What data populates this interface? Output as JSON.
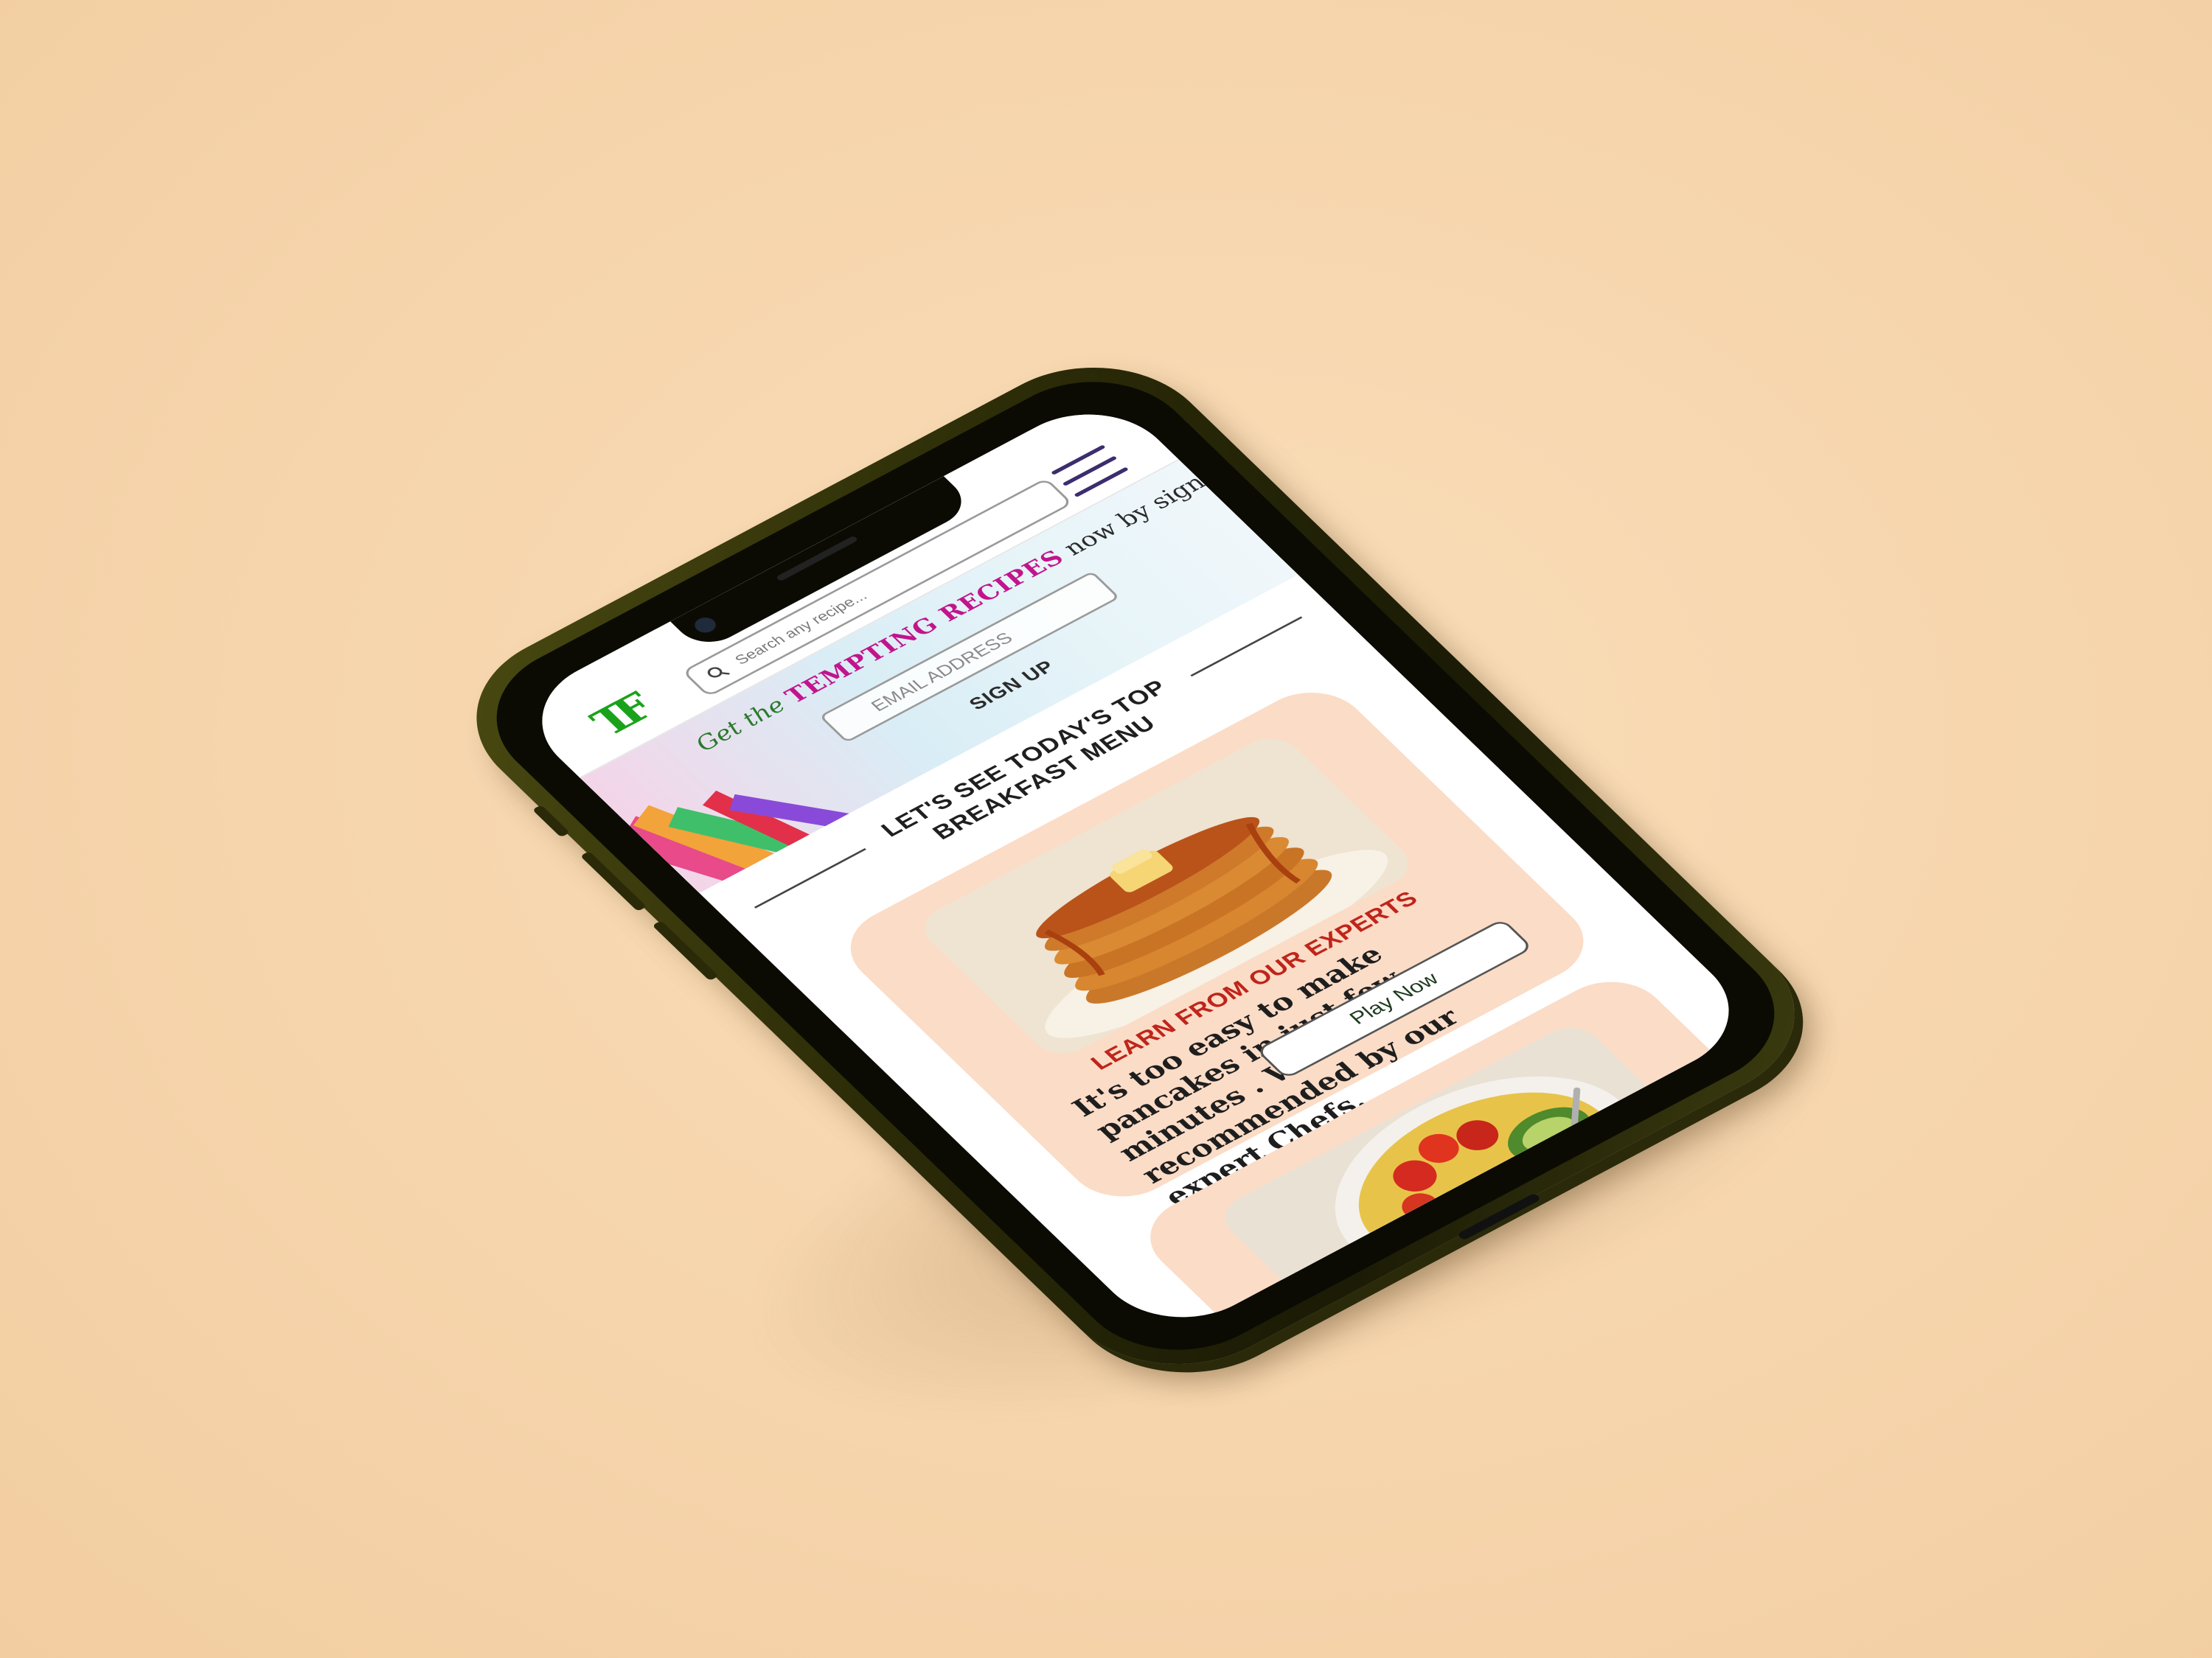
{
  "header": {
    "logo_text": "TF",
    "search": {
      "placeholder": "Search any recipe..."
    },
    "menu_icon": "hamburger-menu-icon"
  },
  "hero": {
    "line_prefix": "Get the",
    "line_highlight": "TEMPTING RECIPES",
    "line_suffix": "now by signing up",
    "email_placeholder": "EMAIL ADDRESS",
    "signup_label": "SIGN UP"
  },
  "section": {
    "title_line1": "LET'S SEE TODAY'S TOP",
    "title_line2": "BREAKFAST MENU"
  },
  "cards": [
    {
      "kicker": "LEARN FROM OUR EXPERTS",
      "body": "It's too easy to make pancakes in just few minutes . Watch this video recommended by our expert Chefs.",
      "button_label": "Play Now",
      "image_icon": "pancakes-image"
    },
    {
      "image_icon": "breakfast-bowl-image"
    }
  ],
  "colors": {
    "background": "#f7d9b1",
    "card": "#fbdcc7",
    "logo_green": "#1aa31a",
    "kicker_red": "#c0241a",
    "menu_purple": "#3b2d6e",
    "phone_body": "#2c2c08"
  }
}
